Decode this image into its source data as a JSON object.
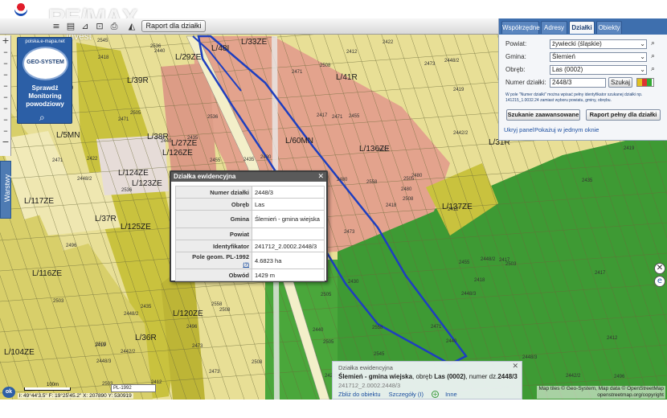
{
  "logo": {
    "brand": "RE/MAX",
    "sub": "Invest"
  },
  "toolbar": {
    "report_button": "Raport dla działki",
    "tool_icons": [
      "layers-icon",
      "menu-icon",
      "ruler-icon",
      "cart-icon",
      "print-icon",
      "measure-icon"
    ]
  },
  "left_nav": {
    "icons": [
      "zoom-in-icon",
      "pan-up-icon",
      "pan-left-icon",
      "pan-right-icon",
      "pan-down-icon",
      "zoom-out-icon"
    ],
    "layers_tab": "Warstwy"
  },
  "geo_banner": {
    "url": "polska.e-mapa.net",
    "name": "GEO-SYSTEM",
    "promo": "Sprawdź Monitoring powodziowy"
  },
  "search_panel": {
    "tabs": [
      "Współrzędne",
      "Adresy",
      "Działki",
      "Obiekty"
    ],
    "active_tab": "Działki",
    "powiat_label": "Powiat:",
    "powiat_value": "żywiecki (śląskie)",
    "gmina_label": "Gmina:",
    "gmina_value": "Ślemień",
    "obreb_label": "Obręb:",
    "obreb_value": "Las (0002)",
    "parcel_label": "Numer działki:",
    "parcel_value": "2448/3",
    "search_button": "Szukaj",
    "hint": "W pole \"Numer działki\" można wpisać pełny identyfikator szukanej działki np. 141215_1.0032.24 zamiast wyboru powiatu, gminy, obrębu.",
    "advanced_button": "Szukanie zaawansowane",
    "report_button": "Raport pełny dla działki",
    "hide_link": "Ukryj panel",
    "window_link": "Pokażuj w jednym oknie"
  },
  "popup": {
    "title": "Działka ewidencyjna",
    "rows": [
      {
        "label": "Numer działki",
        "value": "2448/3"
      },
      {
        "label": "Obręb",
        "value": "Las"
      },
      {
        "label": "Gmina",
        "value": "Ślemień - gmina wiejska"
      },
      {
        "label": "Powiat",
        "value": ""
      },
      {
        "label": "Identyfikator",
        "value": "241712_2.0002.2448/3"
      },
      {
        "label": "Pole geom. PL-1992",
        "value": "4.6823 ha"
      },
      {
        "label": "Obwód",
        "value": "1429 m"
      }
    ],
    "help_mark": "(?)"
  },
  "info_panel": {
    "title": "Działka ewidencyjna",
    "gmina": "Ślemień - gmina wiejska",
    "obreb_text": ", obręb ",
    "obreb": "Las (0002)",
    "number_text": ", numer dz.",
    "number": "2448/3",
    "identifier": "241712_2.0002.2448/3",
    "links": [
      "Zbliż do obiektu",
      "Szczegóły (I)",
      "Inne"
    ]
  },
  "map": {
    "zone_labels": [
      "L/33ZE",
      "L/48I",
      "L/29ZE",
      "L/39R",
      "L/38R",
      "L/27ZE",
      "L/126ZE",
      "L/5MN",
      "L/124ZE",
      "L/123ZE",
      "L/117ZE",
      "L/37R",
      "L/125ZE",
      "L/116ZE",
      "L/120ZE",
      "L/36R",
      "L/104ZE",
      "L/60MN",
      "L/41R",
      "L/136ZE",
      "L/137ZE",
      "L/31R"
    ],
    "colors": {
      "forest": "#3e9a34",
      "agriculture": "#e8df96",
      "residential": "#e3a38d",
      "greenery": "#c9c23e",
      "boundary": "#1e3fbf"
    }
  },
  "scale": {
    "label": "100m",
    "projection": "PL-1992"
  },
  "coords": "ł: 49°44'3.5\" F: 19°25'45.2\" X: 207890 Y: 530919",
  "attribution": [
    "Map tiles © Geo-System, Map data © OpenStreetMap",
    "openstreetmap.org/copyright"
  ],
  "ok_button": "ok"
}
